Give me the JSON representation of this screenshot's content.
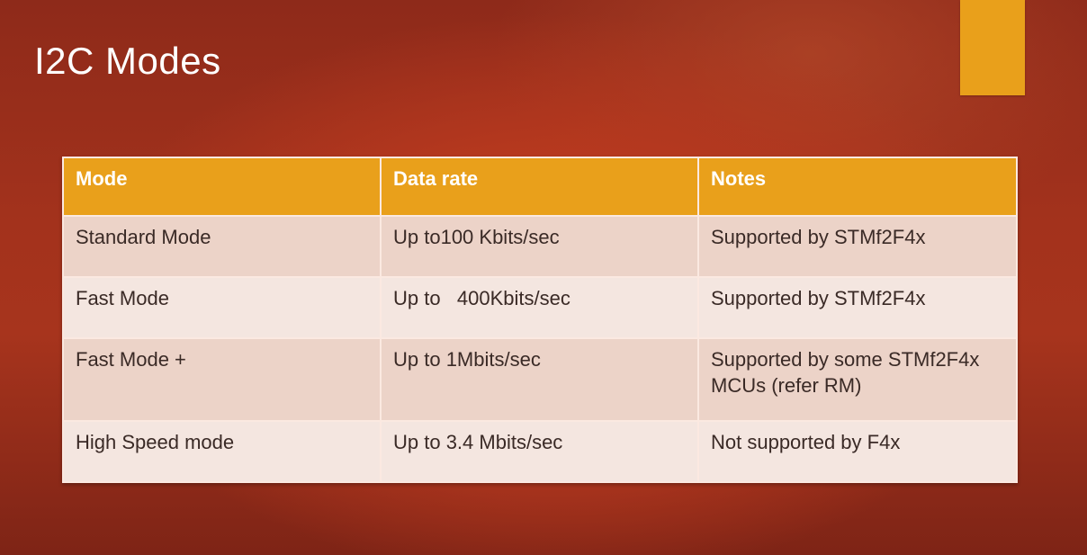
{
  "slide": {
    "title": "I2C Modes"
  },
  "table": {
    "headers": [
      "Mode",
      "Data rate",
      "Notes"
    ],
    "rows": [
      [
        "Standard Mode",
        "Up to100 Kbits/sec",
        "Supported by STMf2F4x"
      ],
      [
        "Fast Mode",
        "Up to   400Kbits/sec",
        "Supported by STMf2F4x"
      ],
      [
        "Fast Mode +",
        "Up to 1Mbits/sec",
        "Supported by some STMf2F4x MCUs (refer RM)"
      ],
      [
        "High Speed mode",
        "Up to 3.4 Mbits/sec",
        "Not supported by F4x"
      ]
    ]
  },
  "colors": {
    "background": "#b8391f",
    "accent": "#e9a01b",
    "row_dark": "#ecd3c8",
    "row_light": "#f4e6e0"
  }
}
